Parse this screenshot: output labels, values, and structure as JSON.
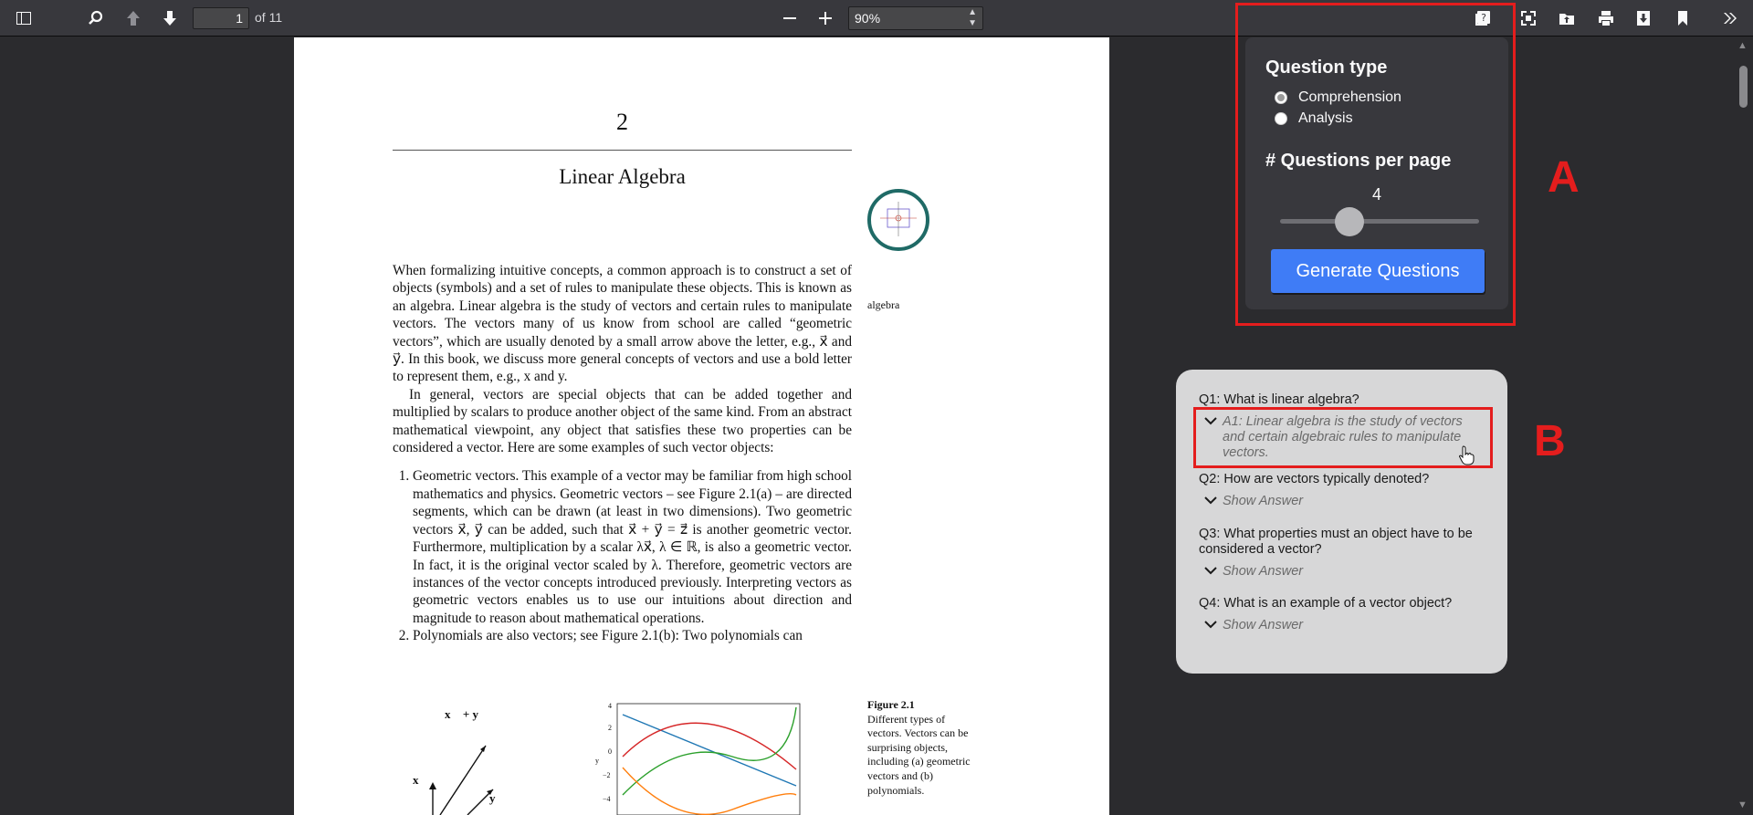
{
  "toolbar": {
    "page_current": "1",
    "page_total": "of 11",
    "zoom": "90%"
  },
  "pdf": {
    "chapter_number": "2",
    "chapter_title": "Linear Algebra",
    "margin_note": "algebra",
    "para1": "When formalizing intuitive concepts, a common approach is to construct a set of objects (symbols) and a set of rules to manipulate these objects. This is known as an algebra. Linear algebra is the study of vectors and certain rules to manipulate vectors. The vectors many of us know from school are called “geometric vectors”, which are usually denoted by a small arrow above the letter, e.g., x⃗ and y⃗. In this book, we discuss more general concepts of vectors and use a bold letter to represent them, e.g., x and y.",
    "para2": "In general, vectors are special objects that can be added together and multiplied by scalars to produce another object of the same kind. From an abstract mathematical viewpoint, any object that satisfies these two properties can be considered a vector. Here are some examples of such vector objects:",
    "item1": "Geometric vectors. This example of a vector may be familiar from high school mathematics and physics. Geometric vectors – see Figure 2.1(a) – are directed segments, which can be drawn (at least in two dimensions). Two geometric vectors x⃗, y⃗ can be added, such that x⃗ + y⃗ = z⃗ is another geometric vector. Furthermore, multiplication by a scalar λx⃗, λ ∈ ℝ, is also a geometric vector. In fact, it is the original vector scaled by λ. Therefore, geometric vectors are instances of the vector concepts introduced previously. Interpreting vectors as geometric vectors enables us to use our intuitions about direction and magnitude to reason about mathematical operations.",
    "item2": "Polynomials are also vectors; see Figure 2.1(b): Two polynomials can",
    "figure_label": "Figure 2.1",
    "figure_caption": "Different types of vectors. Vectors can be surprising objects, including (a) geometric vectors and (b) polynomials.",
    "fig_a_labels": [
      "x⃗ + y⃗",
      "x⃗",
      "y⃗"
    ],
    "fig_b_ticks": [
      "4",
      "2",
      "0",
      "−2",
      "−4"
    ],
    "fig_b_ylabel": "y"
  },
  "panel_a": {
    "question_type_heading": "Question type",
    "options": [
      "Comprehension",
      "Analysis"
    ],
    "selected_option": "Comprehension",
    "questions_per_page_heading": "# Questions per page",
    "questions_per_page": "4",
    "slider_min": 1,
    "slider_max": 10,
    "slider_value": 4,
    "generate_button": "Generate Questions",
    "annotation_label": "A"
  },
  "panel_b": {
    "annotation_label": "B",
    "items": [
      {
        "question": "Q1: What is linear algebra?",
        "answer": "A1: Linear algebra is the study of vectors and certain algebraic rules to manipulate vectors."
      },
      {
        "question": "Q2: How are vectors typically denoted?",
        "answer": "Show Answer"
      },
      {
        "question": "Q3: What properties must an object have to be considered a vector?",
        "answer": "Show Answer"
      },
      {
        "question": "Q4: What is an example of a vector object?",
        "answer": "Show Answer"
      }
    ]
  },
  "colors": {
    "accent_button": "#3f7cf6",
    "annotation_red": "#e41d1d",
    "toolbar_bg": "#38383d",
    "viewer_bg": "#2b2b2e"
  }
}
